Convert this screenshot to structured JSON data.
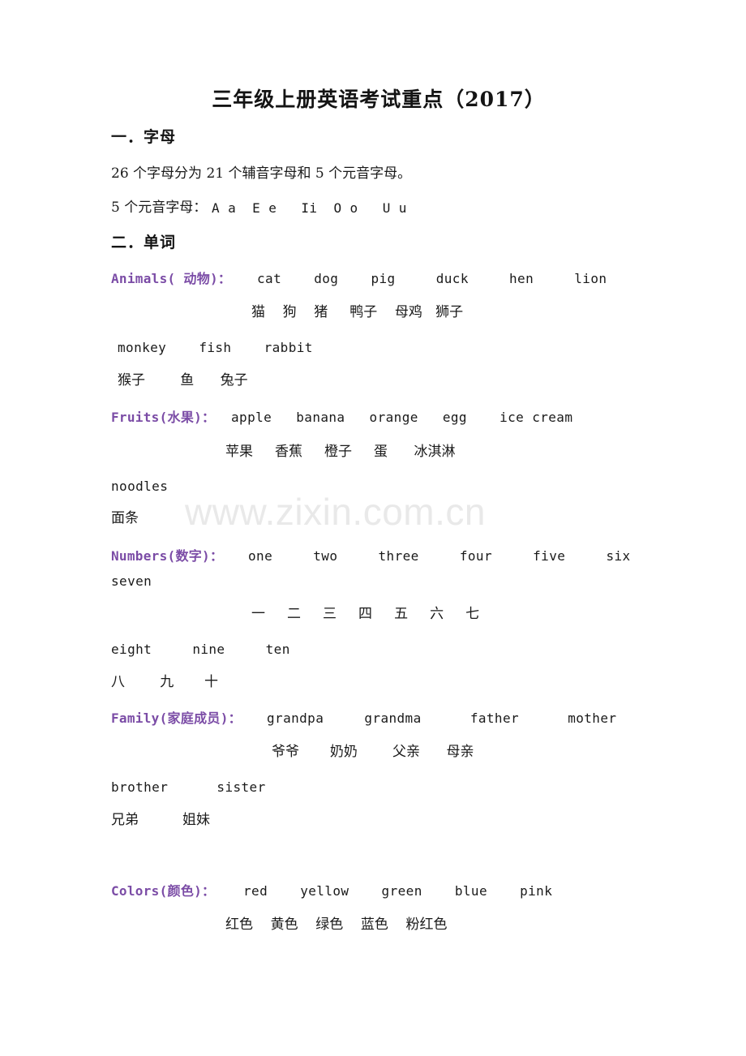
{
  "document": {
    "title": "三年级上册英语考试重点（2017）",
    "watermark": "www.zixin.com.cn",
    "accent_color": "#7B4CA6",
    "text_color": "#1a1a1a",
    "watermark_color": "#e9e9e9"
  },
  "sections": [
    {
      "heading": "一．字母",
      "lines": [
        "26 个字母分为 21 个辅音字母和 5 个元音字母。",
        "5 个元音字母："
      ],
      "vowels": "A a  E e   Ii  O o   U u"
    },
    {
      "heading": "二．单词"
    }
  ],
  "vocab": {
    "animals": {
      "label": "Animals( 动物)：",
      "en_row1": "cat    dog    pig     duck     hen     lion",
      "cn_row1": "猫    狗    猪     鸭子    母鸡   狮子",
      "en_row2": "monkey    fish    rabbit",
      "cn_row2": "猴子        鱼      兔子"
    },
    "fruits": {
      "label": "Fruits(水果)：",
      "en_row1": "apple   banana   orange   egg    ice cream",
      "cn_row1": "苹果     香蕉     橙子     蛋      冰淇淋",
      "en_row2": "noodles",
      "cn_row2": "面条"
    },
    "numbers": {
      "label": "Numbers(数字)：",
      "en_row1": "one     two     three     four     five     six",
      "en_row1_cont": "seven",
      "cn_row1": "一     二     三     四     五     六     七",
      "en_row2": "eight     nine     ten",
      "cn_row2": "八        九       十"
    },
    "family": {
      "label": "Family(家庭成员)：",
      "en_row1": "grandpa     grandma      father      mother",
      "cn_row1": "爷爷       奶奶        父亲      母亲",
      "en_row2": "brother      sister",
      "cn_row2": "兄弟          姐妹"
    },
    "colors": {
      "label": "Colors(颜色)：",
      "en_row1": "red    yellow    green    blue    pink",
      "cn_row1": "红色    黄色    绿色    蓝色    粉红色"
    }
  }
}
